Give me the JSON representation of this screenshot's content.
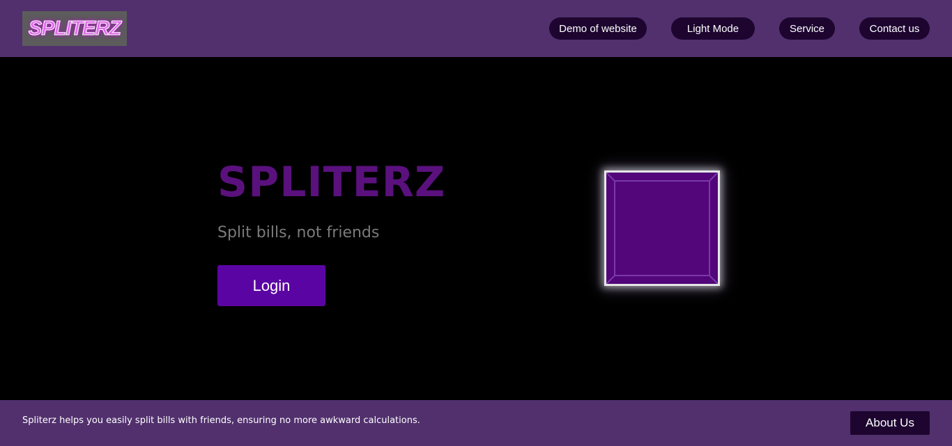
{
  "header": {
    "logo_text": "SPLITERZ",
    "nav": [
      {
        "label": "Demo of website"
      },
      {
        "label": "Light Mode"
      },
      {
        "label": "Service"
      },
      {
        "label": "Contact us"
      }
    ]
  },
  "hero": {
    "title": "SPLITERZ",
    "subtitle": "Split bills, not friends",
    "login_label": "Login"
  },
  "footer": {
    "text": "Spliterz helps you easily split bills with friends, ensuring no more awkward calculations.",
    "about_label": "About Us"
  },
  "colors": {
    "header_bg": "#51306d",
    "nav_button_bg": "#1d0530",
    "title": "#5a117d",
    "login_button_bg": "#5b04a4",
    "cube_fill": "#52067a"
  }
}
